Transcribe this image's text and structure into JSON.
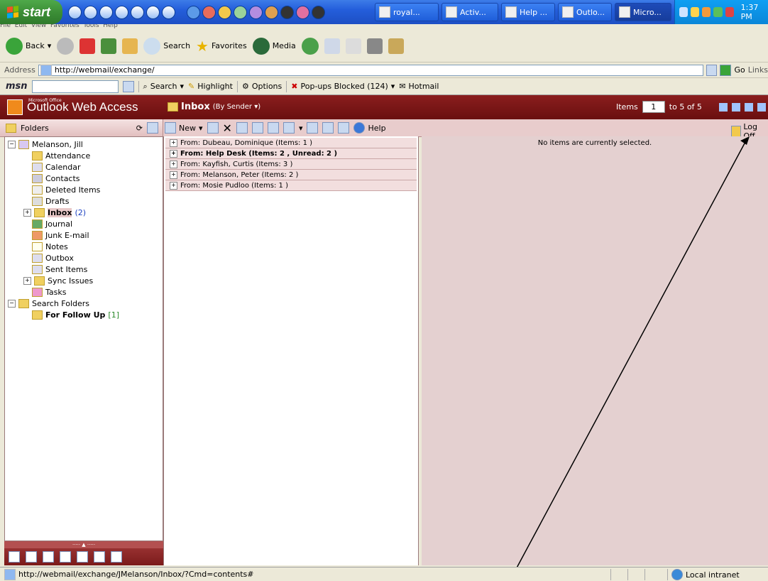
{
  "taskbar": {
    "start_label": "start",
    "buttons": [
      {
        "label": "royal..."
      },
      {
        "label": "Activ..."
      },
      {
        "label": "Help ..."
      },
      {
        "label": "Outlo..."
      },
      {
        "label": "Micro..."
      }
    ],
    "clock": "1:37 PM"
  },
  "ie": {
    "toolbar": {
      "back": "Back",
      "search": "Search",
      "favorites": "Favorites",
      "media": "Media"
    },
    "address_label": "Address",
    "address_url": "http://webmail/exchange/",
    "go_label": "Go",
    "links_label": "Links",
    "msn": {
      "logo": "msn",
      "search": "Search",
      "highlight": "Highlight",
      "options": "Options",
      "popups": "Pop-ups Blocked (124)",
      "hotmail": "Hotmail"
    }
  },
  "owa": {
    "brand_small": "Microsoft Office",
    "brand": "Outlook Web Access",
    "view_title": "Inbox",
    "view_mode": "(By Sender",
    "items_label": "Items",
    "page_value": "1",
    "page_range": "to 5 of 5",
    "folders_label": "Folders",
    "new_label": "New",
    "help_label": "Help",
    "logoff_label": "Log Off",
    "tree": {
      "root": "Melanson, Jill",
      "items": [
        "Attendance",
        "Calendar",
        "Contacts",
        "Deleted Items",
        "Drafts"
      ],
      "inbox": "Inbox",
      "inbox_count": "(2)",
      "items2": [
        "Journal",
        "Junk E-mail",
        "Notes",
        "Outbox",
        "Sent Items",
        "Sync Issues",
        "Tasks"
      ],
      "search_folders": "Search Folders",
      "follow_up": "For Follow Up",
      "follow_up_count": "[1]"
    },
    "groups": [
      {
        "label": "From: Dubeau, Dominique (Items: 1 )",
        "bold": false
      },
      {
        "label": "From: Help Desk (Items: 2 , Unread: 2 )",
        "bold": true
      },
      {
        "label": "From: Kayfish, Curtis (Items: 3 )",
        "bold": false
      },
      {
        "label": "From: Melanson, Peter (Items: 2 )",
        "bold": false
      },
      {
        "label": "From: Mosie Pudloo (Items: 1 )",
        "bold": false
      }
    ],
    "reading_empty": "No items are currently selected."
  },
  "status": {
    "url": "http://webmail/exchange/JMelanson/Inbox/?Cmd=contents#",
    "zone": "Local intranet"
  }
}
